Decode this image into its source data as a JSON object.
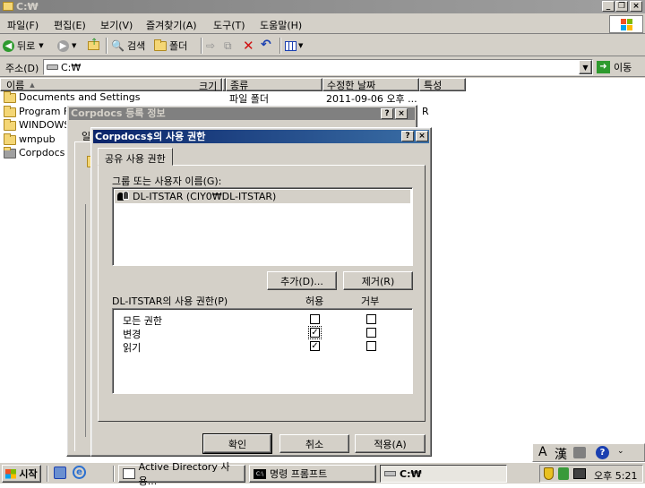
{
  "window": {
    "title": "C:₩"
  },
  "menu": [
    "파일(F)",
    "편집(E)",
    "보기(V)",
    "즐겨찾기(A)",
    "도구(T)",
    "도움말(H)"
  ],
  "toolbar": {
    "back": "뒤로",
    "search": "검색",
    "folders": "폴더"
  },
  "address": {
    "label": "주소(D)",
    "value": "C:₩",
    "go": "이동"
  },
  "columns": {
    "name": "이름",
    "size": "크기",
    "type": "종류",
    "modified": "수정한 날짜",
    "attr": "특성"
  },
  "files": [
    {
      "name": "Documents and Settings",
      "type": "파일 폴더",
      "modified": "2011-09-06 오후 ..."
    },
    {
      "name": "Program F"
    },
    {
      "name": "WINDOWS"
    },
    {
      "name": "wmpub"
    },
    {
      "name": "Corpdocs"
    }
  ],
  "row0_attr": "R",
  "props_dialog": {
    "title": "Corpdocs 등록 정보",
    "tab_fragment": "일"
  },
  "perm_dialog": {
    "title": "Corpdocs$의 사용 권한",
    "tab": "공유 사용 권한",
    "group_label": "그룹 또는 사용자 이름(G):",
    "users": [
      "DL-ITSTAR (CIY0₩DL-ITSTAR)"
    ],
    "add_button": "추가(D)...",
    "remove_button": "제거(R)",
    "perm_label": "DL-ITSTAR의 사용 권한(P)",
    "allow_header": "허용",
    "deny_header": "거부",
    "permissions": [
      {
        "name": "모든 권한",
        "allow": false,
        "deny": false
      },
      {
        "name": "변경",
        "allow": true,
        "deny": false
      },
      {
        "name": "읽기",
        "allow": true,
        "deny": false
      }
    ],
    "ok": "확인",
    "cancel": "취소",
    "apply": "적용(A)"
  },
  "taskbar": {
    "start": "시작",
    "tasks": [
      "Active Directory 사용...",
      "명령 프롬프트",
      "C:₩"
    ],
    "clock": "오후 5:21"
  },
  "langbar": {
    "a": "A",
    "han": "漢"
  },
  "colors": {
    "title_active": "#0a246a",
    "title_inactive": "#808080",
    "face": "#d4d0c8"
  }
}
